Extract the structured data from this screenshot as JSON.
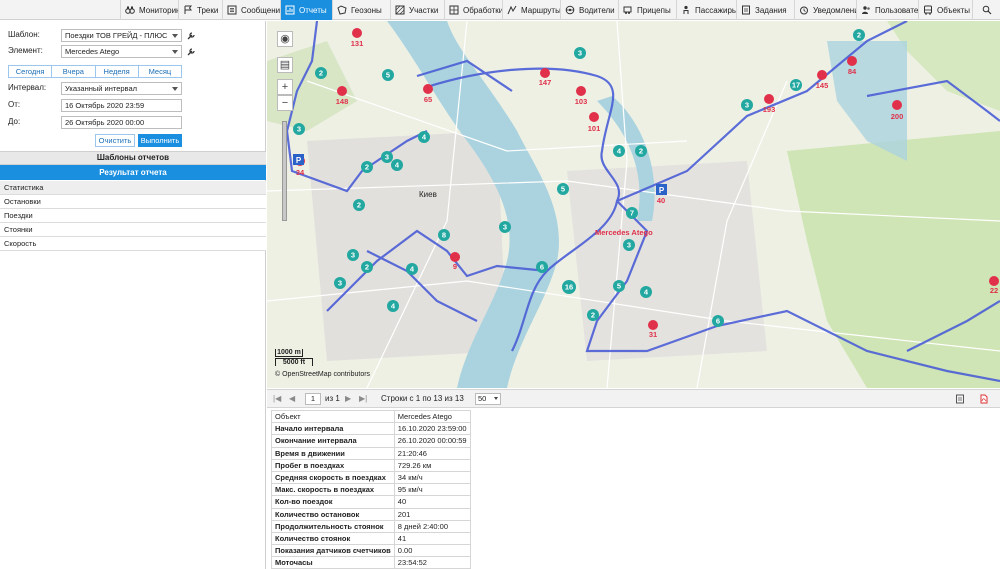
{
  "toolbar": {
    "tabs": [
      {
        "label": "Мониторинг",
        "icon": "binoculars-icon"
      },
      {
        "label": "Треки",
        "icon": "flag-icon"
      },
      {
        "label": "Сообщения",
        "icon": "list-icon"
      },
      {
        "label": "Отчеты",
        "icon": "report-icon",
        "active": true
      },
      {
        "label": "Геозоны",
        "icon": "geofence-icon"
      },
      {
        "label": "Участки",
        "icon": "area-icon"
      },
      {
        "label": "Обработки",
        "icon": "grid-icon"
      },
      {
        "label": "Маршруты",
        "icon": "route-icon"
      },
      {
        "label": "Водители",
        "icon": "driver-icon"
      },
      {
        "label": "Прицепы",
        "icon": "trailer-icon"
      },
      {
        "label": "Пассажиры",
        "icon": "passenger-icon"
      },
      {
        "label": "Задания",
        "icon": "tasks-icon"
      },
      {
        "label": "Уведомления",
        "icon": "alarm-icon"
      },
      {
        "label": "Пользователи",
        "icon": "users-icon"
      },
      {
        "label": "Объекты",
        "icon": "bus-icon"
      }
    ]
  },
  "form": {
    "template_label": "Шаблон:",
    "template_value": "Поездки ТОВ ГРЕЙД - ПЛЮС",
    "element_label": "Элемент:",
    "element_value": "Mercedes Atego",
    "periods": [
      "Сегодня",
      "Вчера",
      "Неделя",
      "Месяц"
    ],
    "interval_label": "Интервал:",
    "interval_value": "Указанный интервал",
    "from_label": "От:",
    "from_value": "16 Октябрь 2020 23:59",
    "to_label": "До:",
    "to_value": "26 Октябрь 2020 00:00",
    "clear_label": "Очистить",
    "run_label": "Выполнить"
  },
  "panels": {
    "templates_header": "Шаблоны отчетов",
    "result_header": "Результат отчета",
    "result_items": [
      "Статистика",
      "Остановки",
      "Поездки",
      "Стоянки",
      "Скорость"
    ]
  },
  "map": {
    "city_label": "Киев",
    "vehicle_label": "Mercedes Atego",
    "scale_m": "1000 m",
    "scale_ft": "5000 ft",
    "attribution": "© OpenStreetMap contributors",
    "stops": [
      "131",
      "147",
      "148",
      "65",
      "101",
      "103",
      "193",
      "145",
      "84",
      "200",
      "34",
      "40",
      "9",
      "31",
      "22"
    ],
    "clusters": [
      "2",
      "5",
      "3",
      "4",
      "2",
      "4",
      "3",
      "3",
      "17",
      "2",
      "2",
      "5",
      "4",
      "2",
      "2",
      "3",
      "7",
      "8",
      "3",
      "3",
      "2",
      "3",
      "4",
      "6",
      "16",
      "5",
      "4",
      "2",
      "6",
      "4",
      "2",
      "3"
    ]
  },
  "pager": {
    "page": "1",
    "of_label": "из 1",
    "rows_label": "Строки с 1 по 13 из 13",
    "page_size": "50"
  },
  "table": {
    "rows": [
      {
        "k": "Объект",
        "v": "Mercedes Atego"
      },
      {
        "k": "Начало интервала",
        "v": "16.10.2020 23:59:00"
      },
      {
        "k": "Окончание интервала",
        "v": "26.10.2020 00:00:59"
      },
      {
        "k": "Время в движении",
        "v": "21:20:46"
      },
      {
        "k": "Пробег в поездках",
        "v": "729.26 км"
      },
      {
        "k": "Средняя скорость в поездках",
        "v": "34 км/ч"
      },
      {
        "k": "Макс. скорость в поездках",
        "v": "95 км/ч"
      },
      {
        "k": "Кол-во поездок",
        "v": "40"
      },
      {
        "k": "Количество остановок",
        "v": "201"
      },
      {
        "k": "Продолжительность стоянок",
        "v": "8 дней 2:40:00"
      },
      {
        "k": "Количество стоянок",
        "v": "41"
      },
      {
        "k": "Показания датчиков счетчиков",
        "v": "0.00"
      },
      {
        "k": "Моточасы",
        "v": "23:54:52"
      }
    ]
  },
  "colors": {
    "accent": "#1a8fe0",
    "track": "#4b5ed6",
    "stop": "#e0304a",
    "cluster": "#22a8a0"
  }
}
